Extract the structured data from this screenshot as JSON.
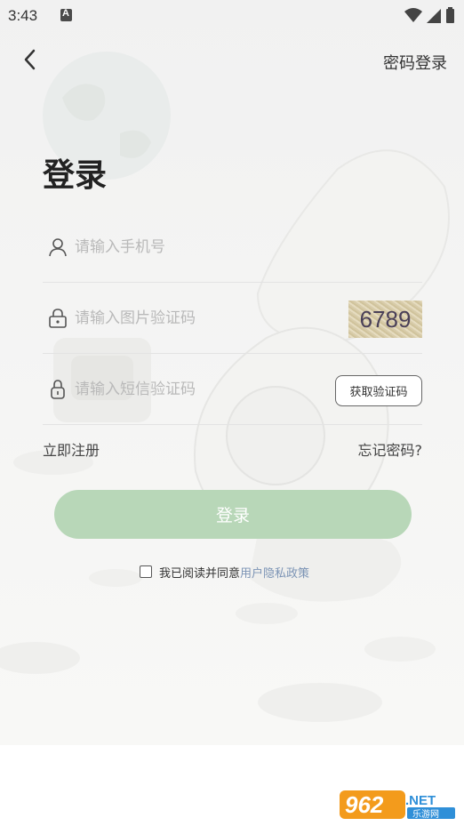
{
  "status_bar": {
    "time": "3:43"
  },
  "nav": {
    "password_login": "密码登录"
  },
  "title": "登录",
  "fields": {
    "phone_placeholder": "请输入手机号",
    "image_code_placeholder": "请输入图片验证码",
    "captcha_text": "6789",
    "sms_code_placeholder": "请输入短信验证码",
    "sms_button": "获取验证码"
  },
  "links": {
    "register": "立即注册",
    "forgot": "忘记密码?"
  },
  "login_button": "登录",
  "agreement": {
    "text": "我已阅读并同意",
    "link": "用户隐私政策",
    "checked": false
  },
  "watermark": {
    "number": "962",
    "suffix": ".NET",
    "sub": "乐游网"
  },
  "colors": {
    "login_button": "#b8d7b8",
    "link": "#7c94b5",
    "watermark_orange": "#f39b1c",
    "watermark_blue": "#2f8fd8"
  },
  "icons": [
    "back-icon",
    "user-icon",
    "lock-image-icon",
    "lock-icon",
    "wifi-icon",
    "signal-icon",
    "battery-icon"
  ]
}
